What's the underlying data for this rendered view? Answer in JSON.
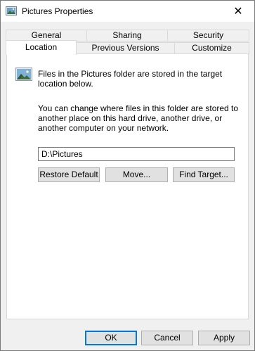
{
  "window": {
    "title": "Pictures Properties",
    "close_glyph": "✕"
  },
  "tabs_row1": [
    {
      "label": "General"
    },
    {
      "label": "Sharing"
    },
    {
      "label": "Security"
    }
  ],
  "tabs_row2": [
    {
      "label": "Location",
      "active": true
    },
    {
      "label": "Previous Versions"
    },
    {
      "label": "Customize"
    }
  ],
  "location": {
    "description": "Files in the Pictures folder are stored in the target location below.",
    "info": "You can change where files in this folder are stored to another place on this hard drive, another drive, or another computer on your network.",
    "path_value": "D:\\Pictures",
    "restore_default_label": "Restore Default",
    "move_label": "Move...",
    "find_target_label": "Find Target..."
  },
  "footer": {
    "ok_label": "OK",
    "cancel_label": "Cancel",
    "apply_label": "Apply"
  },
  "colors": {
    "accent": "#0078d7",
    "border": "#d9d9d9",
    "face": "#f0f0f0"
  }
}
